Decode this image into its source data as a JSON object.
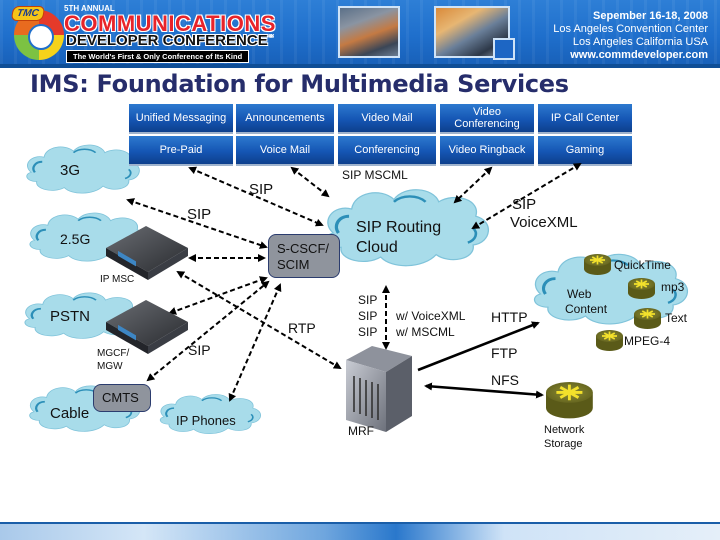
{
  "banner": {
    "logo_badge": "TMC",
    "annual": "5TH ANNUAL",
    "title_line1": "COMMUNICATIONS",
    "title_line2": "DEVELOPER CONFERENCE",
    "trademark": "™",
    "tagline": "The World's First & Only Conference of Its Kind",
    "date": "Sepember 16-18, 2008",
    "venue": "Los Angeles Convention Center",
    "location": "Los Angeles California USA",
    "website": "www.commdeveloper.com"
  },
  "slide": {
    "title": "IMS: Foundation for Multimedia Services"
  },
  "services": {
    "row1": [
      "Unified Messaging",
      "Announcements",
      "Video Mail",
      "Video Conferencing",
      "IP Call Center"
    ],
    "row2": [
      "Pre-Paid",
      "Voice Mail",
      "Conferencing",
      "Video Ringback",
      "Gaming"
    ]
  },
  "networks": {
    "cloud_3g": "3G",
    "cloud_25g": "2.5G",
    "cloud_pstn": "PSTN",
    "cloud_cable": "Cable",
    "cloud_ip_phones": "IP Phones",
    "cloud_sip_routing_line1": "SIP Routing",
    "cloud_sip_routing_line2": "Cloud",
    "cloud_web_line1": "Web",
    "cloud_web_line2": "Content"
  },
  "nodes": {
    "ip_msc": "IP MSC",
    "mgcf_line1": "MGCF/",
    "mgcf_line2": "MGW",
    "cmts": "CMTS",
    "scscf_line1": "S-CSCF/",
    "scscf_line2": "SCIM",
    "mrf": "MRF",
    "network_storage_line1": "Network",
    "network_storage_line2": "Storage"
  },
  "media_types": [
    "QuickTime",
    "mp3",
    "Text",
    "MPEG-4"
  ],
  "protocols": {
    "sip_mscml": "SIP MSCML",
    "sip_top": "SIP",
    "sip_left": "SIP",
    "sip_voicexml_line1": "SIP",
    "sip_voicexml_line2": "VoiceXML",
    "rtp": "RTP",
    "sip_lower": "SIP",
    "mrf_sip_lines": [
      "SIP",
      "SIP",
      "SIP"
    ],
    "mrf_sip_suffix": [
      "",
      "w/ VoiceXML",
      "w/ MSCML"
    ],
    "http": "HTTP",
    "ftp": "FTP",
    "nfs": "NFS"
  },
  "colors": {
    "title": "#262d6b",
    "service_button": "#1556b4",
    "cloud_fill": "#a8dcea",
    "cloud_stroke": "#3aa0c4",
    "box_fill": "#8f949d",
    "router": "#7c7c2a"
  }
}
